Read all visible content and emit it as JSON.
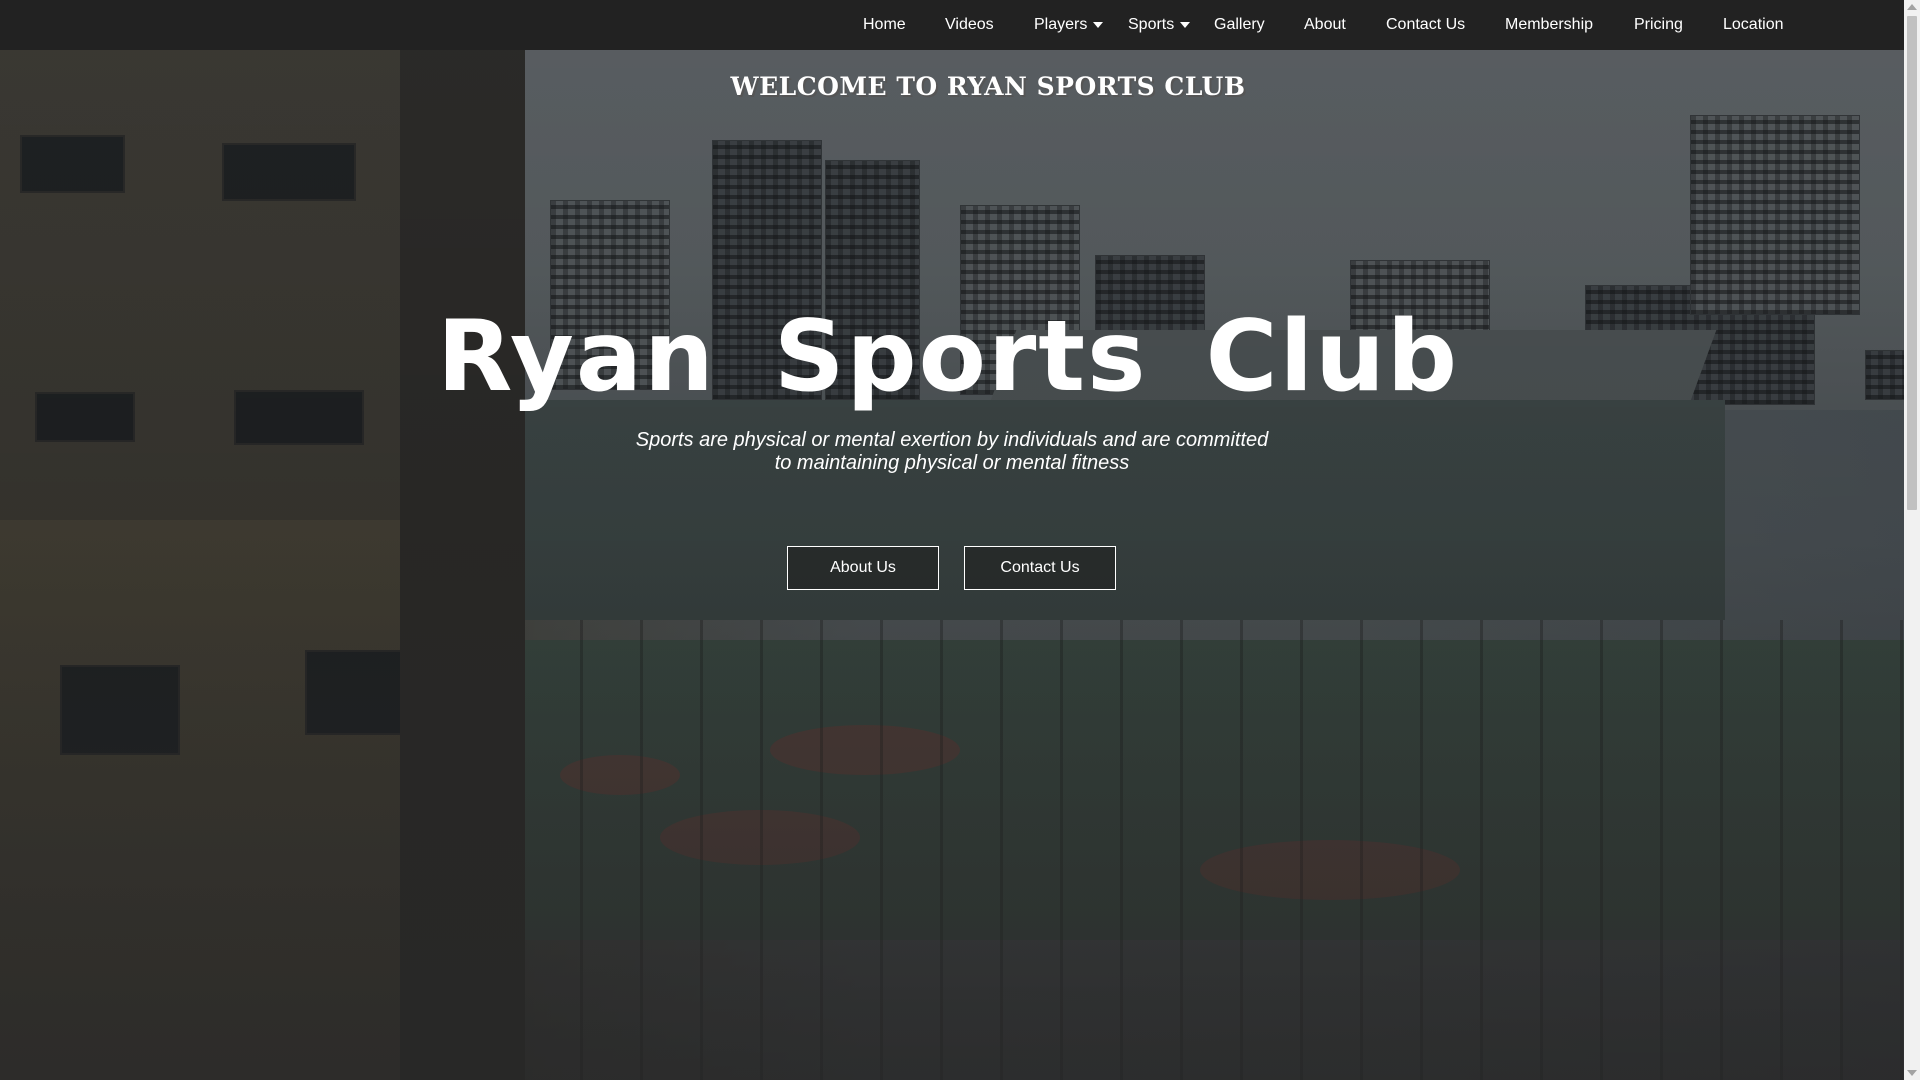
{
  "nav": {
    "items": [
      {
        "label": "Home"
      },
      {
        "label": "Videos"
      },
      {
        "label": "Players",
        "dropdown": true
      },
      {
        "label": "Sports",
        "dropdown": true
      },
      {
        "label": "Gallery"
      },
      {
        "label": "About"
      },
      {
        "label": "Contact Us"
      },
      {
        "label": "Membership"
      },
      {
        "label": "Pricing"
      },
      {
        "label": "Location"
      }
    ]
  },
  "hero": {
    "welcome": "WELCOME TO RYAN SPORTS CLUB",
    "title": "Ryan Sports Club",
    "description_line1": "Sports are physical or mental exertion by individuals and are committed",
    "description_line2": "to maintaining physical or mental fitness",
    "buttons": {
      "about": "About Us",
      "contact": "Contact Us"
    }
  },
  "colors": {
    "navbar": "#222222",
    "text": "#ffffff",
    "scrollbar_track": "#f1f1f1",
    "scrollbar_thumb": "#c1c1c1"
  }
}
